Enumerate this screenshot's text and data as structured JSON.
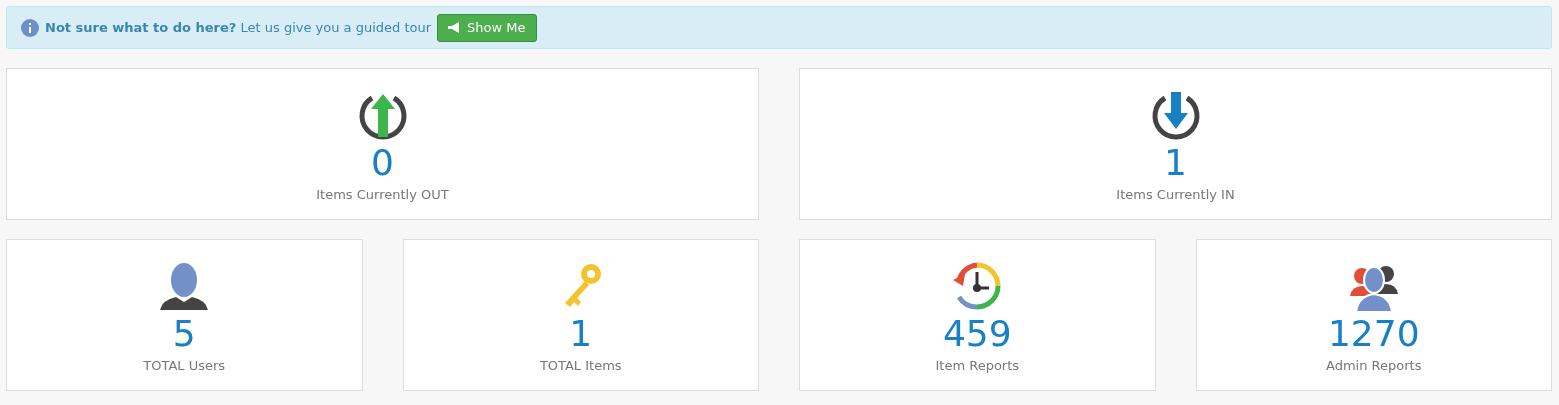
{
  "banner": {
    "text": "**Not sure what to do here?** Let us give you a guided tour",
    "button": "Show Me"
  },
  "cards": [
    {
      "kind": "out",
      "value": "0",
      "label": "Items Currently OUT"
    },
    {
      "kind": "in",
      "value": "1",
      "label": "Items Currently IN"
    },
    {
      "kind": "users",
      "value": "5",
      "label": "TOTAL Users"
    },
    {
      "kind": "items",
      "value": "1",
      "label": "TOTAL Items"
    },
    {
      "kind": "item-reports",
      "value": "459",
      "label": "Item Reports"
    },
    {
      "kind": "admin-reports",
      "value": "1270",
      "label": "Admin Reports"
    }
  ]
}
